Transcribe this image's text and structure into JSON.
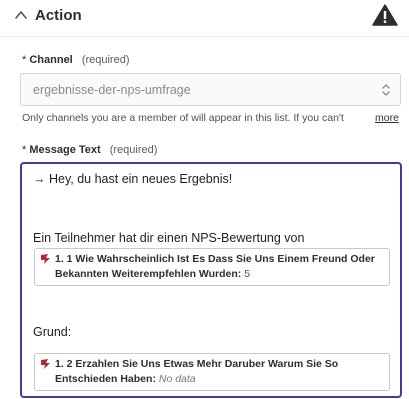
{
  "section": {
    "title": "Action"
  },
  "channel": {
    "star": "*",
    "label": "Channel",
    "required": "(required)",
    "value": "ergebnisse-der-nps-umfrage",
    "hint": "Only channels you are a member of will appear in this list. If you can't",
    "more": "more"
  },
  "message": {
    "star": "*",
    "label": "Message Text",
    "required": "(required)",
    "line1": "→ Hey, du hast ein neues Ergebnis!",
    "line2": "Ein Teilnehmer hat dir einen NPS-Bewertung von",
    "pill1": {
      "label_line1": "1. 1 Wie Wahrscheinlich Ist Es Dass Sie Uns Einem Freund Oder",
      "label_line2": "Bekannten Weiterempfehlen Wurden:",
      "value": "5"
    },
    "line3": "Grund:",
    "pill2": {
      "label_line1": "1. 2 Erzahlen Sie Uns Etwas Mehr Daruber Warum Sie So",
      "label_line2": "Entschieden Haben:",
      "value": "No data"
    }
  },
  "colors": {
    "editor_border": "#3d3d9c",
    "pill_icon": "#b8263a"
  },
  "icons": {
    "collapse": "chevron-up-icon",
    "warning": "warning-triangle-icon",
    "select": "up-down-chevron-icon",
    "app": "app-logo-icon"
  }
}
